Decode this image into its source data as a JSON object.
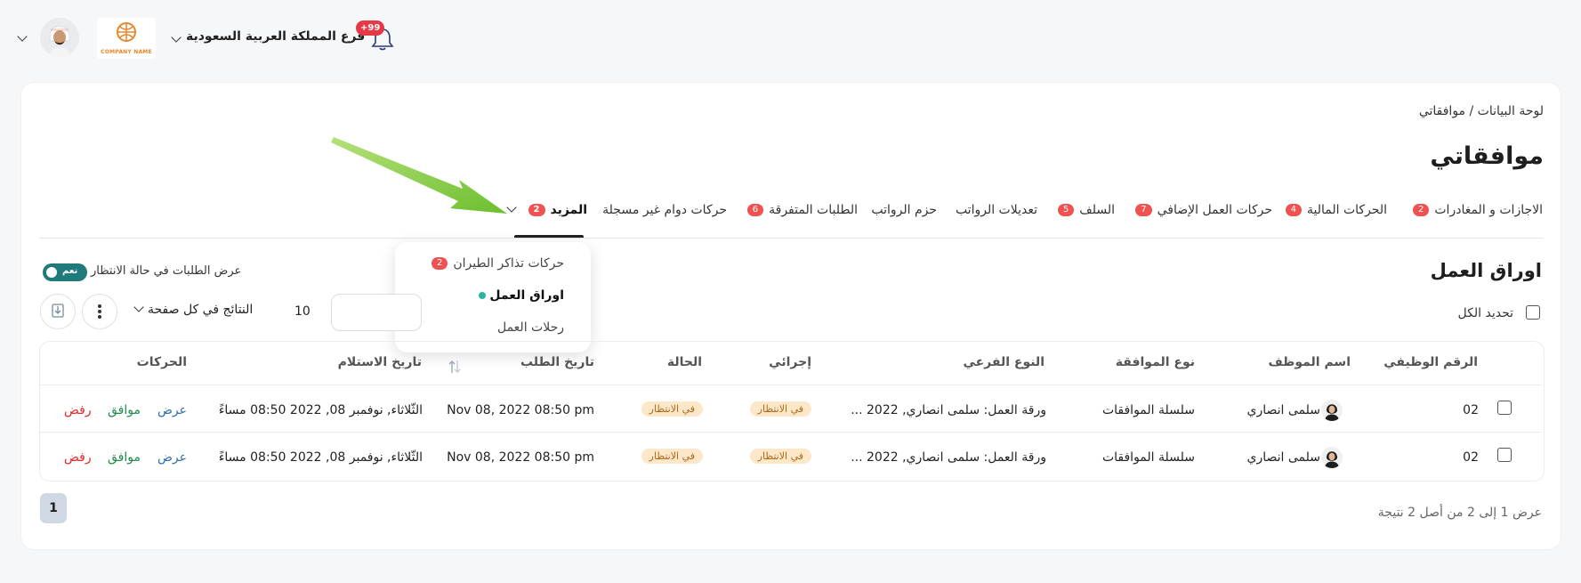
{
  "header": {
    "branch_label": "فرع المملكة العربية السعودية",
    "notification_count": "+99",
    "company_logo_text": "COMPANY NAME",
    "icons": [
      "chevron-down-icon",
      "avatar",
      "company-logo",
      "bell-icon"
    ]
  },
  "breadcrumb": "لوحة البيانات / موافقاتي",
  "page_title": "موافقاتي",
  "tabs": [
    {
      "label": "الاجازات و المغادرات",
      "badge": "2"
    },
    {
      "label": "الحركات المالية",
      "badge": "4"
    },
    {
      "label": "حركات العمل الإضافي",
      "badge": "7"
    },
    {
      "label": "السلف",
      "badge": "5"
    },
    {
      "label": "تعديلات الرواتب",
      "badge": ""
    },
    {
      "label": "حزم الرواتب",
      "badge": ""
    },
    {
      "label": "الطلبات المتفرقة",
      "badge": "6"
    },
    {
      "label": "حركات دوام غير مسجلة",
      "badge": ""
    },
    {
      "label": "المزيد",
      "badge": "2",
      "active": true
    }
  ],
  "more_menu": [
    {
      "label": "حركات تذاكر الطيران",
      "badge": "2"
    },
    {
      "label": "اوراق العمل",
      "active": true
    },
    {
      "label": "رحلات العمل"
    }
  ],
  "section": {
    "title": "اوراق العمل",
    "pending_toggle_label": "عرض الطلبات في حالة الانتظار",
    "pending_toggle_value": "نعم",
    "select_all_label": "تحديد الكل",
    "per_page_value": "10",
    "per_page_label": "النتائج في كل صفحة"
  },
  "table": {
    "columns": [
      "الرقم الوظيفي",
      "اسم الموظف",
      "نوع الموافقة",
      "النوع الفرعي",
      "إجرائي",
      "الحالة",
      "تاريخ الطلب",
      "تاريخ الاستلام",
      "الحركات"
    ],
    "rows": [
      {
        "employee_id": "02",
        "employee_name": "سلمى انصاري",
        "approval_type": "سلسلة الموافقات",
        "sub_type": "ورقة العمل: سلمى انصاري, 2022 ...",
        "procedural": "في الانتظار",
        "status": "في الانتظار",
        "request_date": "Nov 08, 2022 08:50 pm",
        "received_date": "الثّلاثاء, نوفمبر 08, 2022 08:50 مساءً",
        "actions": {
          "view": "عرض",
          "approve": "موافق",
          "reject": "رفض"
        }
      },
      {
        "employee_id": "02",
        "employee_name": "سلمى انصاري",
        "approval_type": "سلسلة الموافقات",
        "sub_type": "ورقة العمل: سلمى انصاري, 2022 ...",
        "procedural": "في الانتظار",
        "status": "في الانتظار",
        "request_date": "Nov 08, 2022 08:50 pm",
        "received_date": "الثّلاثاء, نوفمبر 08, 2022 08:50 مساءً",
        "actions": {
          "view": "عرض",
          "approve": "موافق",
          "reject": "رفض"
        }
      }
    ]
  },
  "pagination": {
    "current_page": "1",
    "info": "عرض 1 إلى 2 من أصل 2 نتيجة"
  },
  "colors": {
    "accent": "#1f7a7a",
    "badge": "#f05252",
    "pending_pill_bg": "#fde7c9",
    "annotation_arrow": "#7cc142"
  }
}
